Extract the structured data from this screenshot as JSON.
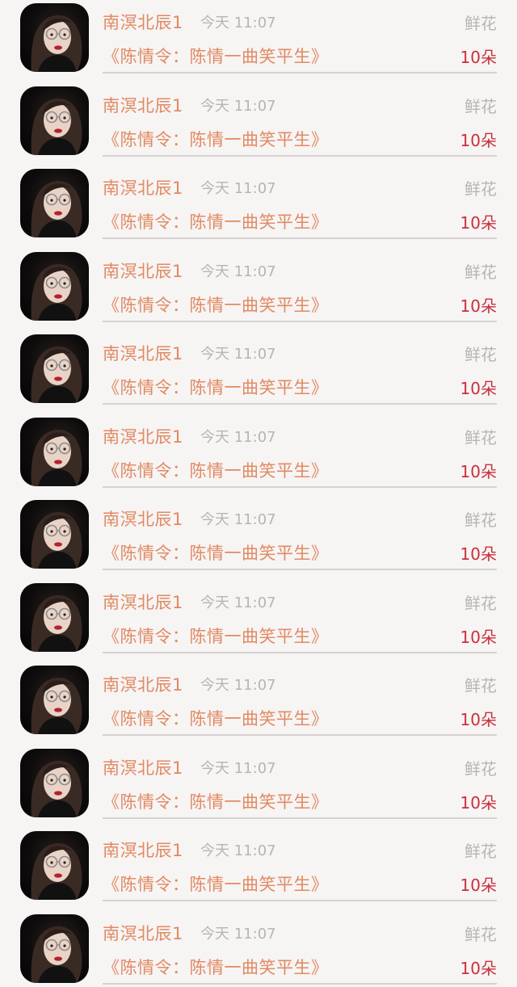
{
  "colors": {
    "background": "#f7f4f4",
    "name_text": "#e08a62",
    "secondary_text": "#b8b4b4",
    "count_text": "#c8313c",
    "divider": "#d6d2d2"
  },
  "avatar_icon": "avatar-icon",
  "rows": [
    {
      "name": "南溟北辰1",
      "time": "今天 11:07",
      "gift": "鲜花",
      "title": "《陈情令：陈情一曲笑平生》",
      "count": "10朵"
    },
    {
      "name": "南溟北辰1",
      "time": "今天 11:07",
      "gift": "鲜花",
      "title": "《陈情令：陈情一曲笑平生》",
      "count": "10朵"
    },
    {
      "name": "南溟北辰1",
      "time": "今天 11:07",
      "gift": "鲜花",
      "title": "《陈情令：陈情一曲笑平生》",
      "count": "10朵"
    },
    {
      "name": "南溟北辰1",
      "time": "今天 11:07",
      "gift": "鲜花",
      "title": "《陈情令：陈情一曲笑平生》",
      "count": "10朵"
    },
    {
      "name": "南溟北辰1",
      "time": "今天 11:07",
      "gift": "鲜花",
      "title": "《陈情令：陈情一曲笑平生》",
      "count": "10朵"
    },
    {
      "name": "南溟北辰1",
      "time": "今天 11:07",
      "gift": "鲜花",
      "title": "《陈情令：陈情一曲笑平生》",
      "count": "10朵"
    },
    {
      "name": "南溟北辰1",
      "time": "今天 11:07",
      "gift": "鲜花",
      "title": "《陈情令：陈情一曲笑平生》",
      "count": "10朵"
    },
    {
      "name": "南溟北辰1",
      "time": "今天 11:07",
      "gift": "鲜花",
      "title": "《陈情令：陈情一曲笑平生》",
      "count": "10朵"
    },
    {
      "name": "南溟北辰1",
      "time": "今天 11:07",
      "gift": "鲜花",
      "title": "《陈情令：陈情一曲笑平生》",
      "count": "10朵"
    },
    {
      "name": "南溟北辰1",
      "time": "今天 11:07",
      "gift": "鲜花",
      "title": "《陈情令：陈情一曲笑平生》",
      "count": "10朵"
    },
    {
      "name": "南溟北辰1",
      "time": "今天 11:07",
      "gift": "鲜花",
      "title": "《陈情令：陈情一曲笑平生》",
      "count": "10朵"
    },
    {
      "name": "南溟北辰1",
      "time": "今天 11:07",
      "gift": "鲜花",
      "title": "《陈情令：陈情一曲笑平生》",
      "count": "10朵"
    }
  ]
}
